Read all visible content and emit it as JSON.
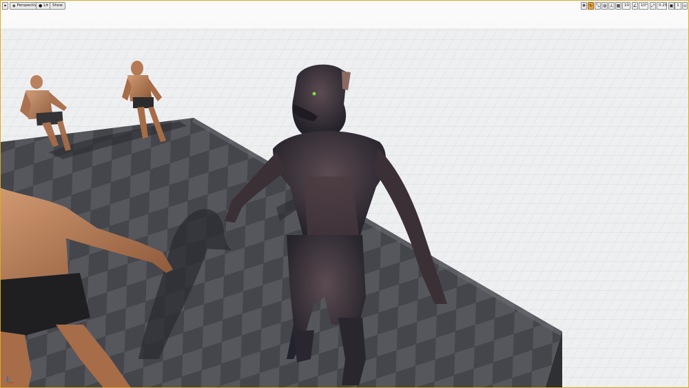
{
  "viewport": {
    "title_menu_icon": "hamburger-chevron-icon",
    "view_mode_label": "Perspective",
    "lit_label": "Lit",
    "show_label": "Show",
    "snap_grid_value": "10",
    "rotation_snap_value": "10°",
    "scale_snap_value": "0.25",
    "camera_speed_value": "1"
  },
  "colors": {
    "viewport_border": "#e0a91c",
    "active_tool": "#e8a33a",
    "floor": "#f2f2f4",
    "platform": "#4f5156"
  }
}
